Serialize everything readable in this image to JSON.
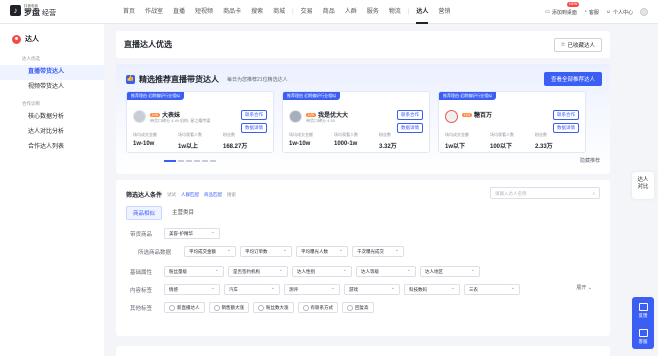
{
  "brand": {
    "sub": "抖音电商",
    "main": "罗盘",
    "suffix": "经营"
  },
  "nav": [
    "首页",
    "作战室",
    "直播",
    "短视频",
    "商品卡",
    "搜索",
    "商城",
    "交易",
    "商品",
    "人群",
    "服务",
    "物流",
    "达人",
    "营销"
  ],
  "nav_active": "达人",
  "topright": {
    "add_desktop": "添加到桌面",
    "new_badge": "NEW",
    "kefu": "客服",
    "personal": "个人中心"
  },
  "sidebar": {
    "title": "达人",
    "groups": [
      {
        "label": "达人优选",
        "items": [
          "直播带货达人",
          "视频带货达人"
        ]
      },
      {
        "label": "合作诊断",
        "items": [
          "核心数据分析",
          "达人对比分析",
          "合作达人列表"
        ]
      }
    ],
    "active": "直播带货达人"
  },
  "header": {
    "title": "直播达人优选",
    "fav_button": "已收藏达人"
  },
  "recommend": {
    "title": "精选推荐直播带货达人",
    "subtitle": "每日为您推荐21位精选达人",
    "view_all": "查看全部推荐达人",
    "hide": "隐藏推荐",
    "cards": [
      {
        "tag": "推荐理由 近期偏好行业相似",
        "name": "大表妹",
        "level": "LV5",
        "sub": "带货口碑分 4.49  机构: 星之耀传媒",
        "btn1": "联系合作",
        "btn2": "数据详情",
        "stats": [
          {
            "label": "场均成交金额",
            "value": "1w-10w"
          },
          {
            "label": "场均观看人数",
            "value": "1w以上"
          },
          {
            "label": "粉丝数",
            "value": "168.27万"
          }
        ]
      },
      {
        "tag": "推荐理由 近期偏好行业相似",
        "name": "我是优大大",
        "level": "LV5",
        "sub": "带货口碑分 4.93",
        "btn1": "联系合作",
        "btn2": "数据详情",
        "stats": [
          {
            "label": "场均成交金额",
            "value": "1w-10w"
          },
          {
            "label": "场均观看人数",
            "value": "1000-1w"
          },
          {
            "label": "粉丝数",
            "value": "3.32万"
          }
        ]
      },
      {
        "tag": "推荐理由 近期偏好行业相似",
        "name": "糖百万",
        "level": "LV3",
        "sub": "",
        "btn1": "联系合作",
        "btn2": "数据详情",
        "stats": [
          {
            "label": "场均成交金额",
            "value": "1w以下"
          },
          {
            "label": "场均观看人数",
            "value": "100以下"
          },
          {
            "label": "粉丝数",
            "value": "2.33万"
          }
        ]
      }
    ]
  },
  "filter": {
    "title": "筛选达人条件",
    "hint": "试试",
    "link1": "人群匹配",
    "link2": "商品匹配",
    "suffix": "搜索",
    "search_placeholder": "请输入达人名称",
    "tabs": [
      "商品相似",
      "主营类目"
    ],
    "active_tab": "商品相似",
    "goods_label": "带货商品",
    "goods_value": "美容-护精华",
    "data_label": "所选商品数据",
    "data_selects": [
      "平均成交金额",
      "平均订单数",
      "平均曝光人数",
      "千次曝光成交"
    ],
    "basic_label": "基础属性",
    "basic_selects": [
      "粉丝量级",
      "是否签约机构",
      "达人性别",
      "达人等级",
      "达人地区"
    ],
    "content_label": "内容标签",
    "content_selects": [
      "情感",
      "汽车",
      "测评",
      "游戏",
      "科技数码",
      "三农"
    ],
    "other_label": "其他标签",
    "other_checks": [
      "新直播达人",
      "销售额大涨",
      "粉丝数大涨",
      "有联系方式",
      "回复高"
    ],
    "expand": "展开"
  },
  "float": {
    "compare": "达人对比",
    "tool1": "反馈",
    "tool2": "客服"
  }
}
